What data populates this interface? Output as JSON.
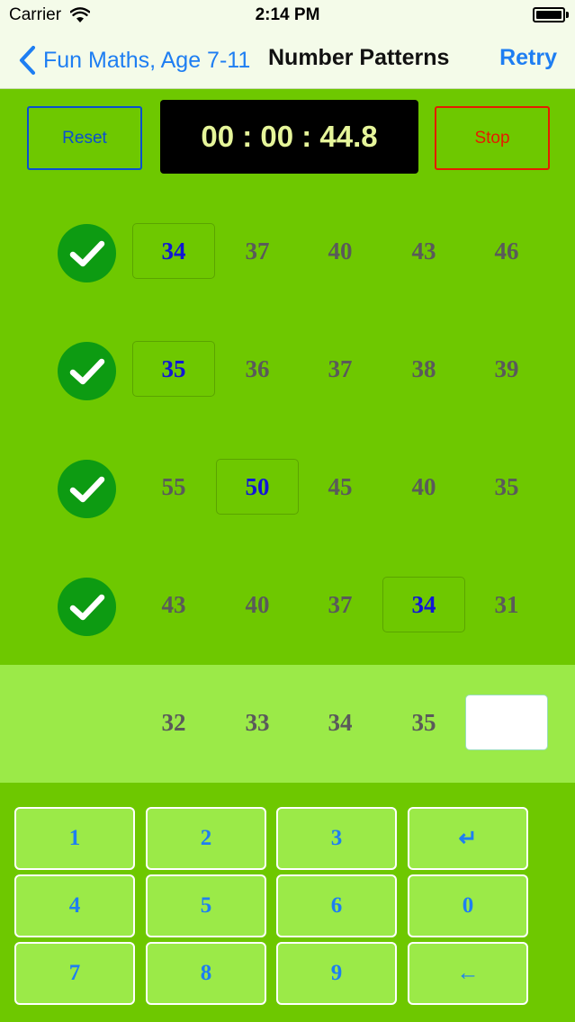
{
  "status_bar": {
    "carrier": "Carrier",
    "time": "2:14 PM"
  },
  "nav": {
    "back_label": "Fun Maths, Age 7-11",
    "title": "Number Patterns",
    "retry_label": "Retry"
  },
  "timer": {
    "reset_label": "Reset",
    "display": "00 : 00 : 44.8",
    "stop_label": "Stop"
  },
  "rows": [
    {
      "status": "correct",
      "cells": [
        "34",
        "37",
        "40",
        "43",
        "46"
      ],
      "answer_index": 0
    },
    {
      "status": "correct",
      "cells": [
        "35",
        "36",
        "37",
        "38",
        "39"
      ],
      "answer_index": 0
    },
    {
      "status": "correct",
      "cells": [
        "55",
        "50",
        "45",
        "40",
        "35"
      ],
      "answer_index": 1
    },
    {
      "status": "correct",
      "cells": [
        "43",
        "40",
        "37",
        "34",
        "31"
      ],
      "answer_index": 3
    }
  ],
  "current_row": {
    "cells": [
      "32",
      "33",
      "34",
      "35"
    ],
    "answer_value": ""
  },
  "keypad": {
    "keys": [
      {
        "label": "1",
        "name": "key-1"
      },
      {
        "label": "2",
        "name": "key-2"
      },
      {
        "label": "3",
        "name": "key-3"
      },
      {
        "label": "↵",
        "name": "key-enter"
      },
      {
        "label": "4",
        "name": "key-4"
      },
      {
        "label": "5",
        "name": "key-5"
      },
      {
        "label": "6",
        "name": "key-6"
      },
      {
        "label": "0",
        "name": "key-0"
      },
      {
        "label": "7",
        "name": "key-7"
      },
      {
        "label": "8",
        "name": "key-8"
      },
      {
        "label": "9",
        "name": "key-9"
      },
      {
        "label": "←",
        "name": "key-backspace"
      }
    ]
  },
  "colors": {
    "background": "#6ec800",
    "active_row": "#9bea48",
    "answer_text": "#1116d6",
    "number_text": "#5a5a5a",
    "check_green": "#0d9b12",
    "ios_blue": "#1e7ef2"
  }
}
